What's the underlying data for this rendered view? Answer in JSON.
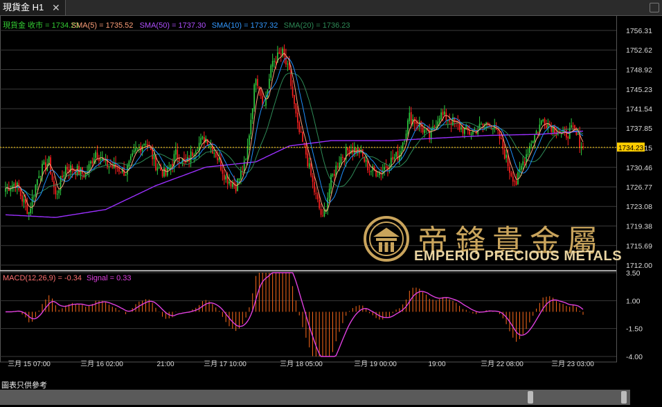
{
  "tab": {
    "title": "現貨金 H1",
    "close": "✕"
  },
  "footer_note": "圖表只供參考",
  "logo": {
    "cn": "帝鋒貴金屬",
    "en": "EMPERIO PRECIOUS METALS"
  },
  "colors": {
    "candle_up": "#2ecc40",
    "candle_down": "#ff2020",
    "sma5": "#ffa07a",
    "sma50": "#9b30ff",
    "sma10": "#1e90ff",
    "sma20": "#2e8b57",
    "macd_hist": "#ff6a1a",
    "signal": "#e040e0",
    "grid": "#3a3a3a",
    "last_price": "#ffcc00"
  },
  "chart_data": [
    {
      "type": "candlestick",
      "legend": [
        {
          "text": "現貨金 收市 = 1734.23",
          "color": "#33cc33"
        },
        {
          "text": "SMA(5) = 1735.52",
          "color": "#ffa07a"
        },
        {
          "text": "SMA(50) = 1737.30",
          "color": "#b050ff"
        },
        {
          "text": "SMA(10) = 1737.32",
          "color": "#3399ff"
        },
        {
          "text": "SMA(20) = 1736.23",
          "color": "#2e8b57"
        }
      ],
      "y_ticks": [
        "1756.31",
        "1752.62",
        "1748.92",
        "1745.23",
        "1741.54",
        "1737.85",
        "1734.15",
        "1730.46",
        "1726.77",
        "1723.08",
        "1719.38",
        "1715.69",
        "1712.00"
      ],
      "ylim": [
        1712.0,
        1756.31
      ],
      "last_price": 1734.23,
      "last_price_label": "1734.23",
      "x_ticks": [
        "三月 15 07:00",
        "三月 16 02:00",
        "21:00",
        "三月 17 10:00",
        "三月 18 05:00",
        "三月 19 00:00",
        "19:00",
        "三月 22 08:00",
        "三月 23 03:00"
      ],
      "close_anchors": [
        [
          0,
          1726.5
        ],
        [
          6,
          1727.5
        ],
        [
          10,
          1724.5
        ],
        [
          14,
          1722.0
        ],
        [
          20,
          1729.5
        ],
        [
          26,
          1731.5
        ],
        [
          30,
          1725.0
        ],
        [
          36,
          1730.5
        ],
        [
          42,
          1730.0
        ],
        [
          48,
          1729.0
        ],
        [
          54,
          1733.5
        ],
        [
          60,
          1731.0
        ],
        [
          66,
          1730.5
        ],
        [
          72,
          1729.5
        ],
        [
          78,
          1733.5
        ],
        [
          84,
          1735.5
        ],
        [
          90,
          1731.0
        ],
        [
          96,
          1729.0
        ],
        [
          102,
          1733.0
        ],
        [
          108,
          1731.0
        ],
        [
          114,
          1734.5
        ],
        [
          120,
          1736.0
        ],
        [
          126,
          1733.0
        ],
        [
          132,
          1728.5
        ],
        [
          138,
          1727.0
        ],
        [
          144,
          1731.5
        ],
        [
          150,
          1748.0
        ],
        [
          155,
          1742.0
        ],
        [
          160,
          1750.5
        ],
        [
          166,
          1752.0
        ],
        [
          170,
          1748.0
        ],
        [
          175,
          1738.0
        ],
        [
          180,
          1733.0
        ],
        [
          185,
          1726.0
        ],
        [
          190,
          1720.5
        ],
        [
          195,
          1728.0
        ],
        [
          200,
          1732.0
        ],
        [
          206,
          1734.0
        ],
        [
          212,
          1733.5
        ],
        [
          218,
          1730.0
        ],
        [
          224,
          1729.5
        ],
        [
          230,
          1731.5
        ],
        [
          236,
          1733.0
        ],
        [
          242,
          1740.0
        ],
        [
          248,
          1738.5
        ],
        [
          254,
          1736.0
        ],
        [
          260,
          1740.5
        ],
        [
          266,
          1739.5
        ],
        [
          272,
          1738.0
        ],
        [
          278,
          1737.0
        ],
        [
          284,
          1738.0
        ],
        [
          290,
          1739.0
        ],
        [
          296,
          1736.0
        ],
        [
          302,
          1730.0
        ],
        [
          306,
          1727.5
        ],
        [
          310,
          1731.5
        ],
        [
          316,
          1736.0
        ],
        [
          322,
          1739.5
        ],
        [
          328,
          1738.0
        ],
        [
          334,
          1736.5
        ],
        [
          340,
          1737.5
        ],
        [
          346,
          1734.23
        ]
      ],
      "sma50_anchors": [
        [
          0,
          1721.5
        ],
        [
          30,
          1721.0
        ],
        [
          60,
          1722.5
        ],
        [
          90,
          1727.0
        ],
        [
          120,
          1730.5
        ],
        [
          150,
          1731.5
        ],
        [
          170,
          1734.5
        ],
        [
          195,
          1735.5
        ],
        [
          230,
          1735.5
        ],
        [
          260,
          1736.0
        ],
        [
          290,
          1736.5
        ],
        [
          320,
          1736.7
        ],
        [
          346,
          1737.3
        ]
      ]
    },
    {
      "type": "macd",
      "legend": [
        {
          "text": "MACD(12,26,9) = -0.34",
          "color": "#ff7070"
        },
        {
          "text": "Signal = 0.33",
          "color": "#e040e0"
        }
      ],
      "y_ticks": [
        "3.50",
        "1.00",
        "-1.50",
        "-4.00"
      ],
      "ylim": [
        -4.0,
        3.5
      ]
    }
  ]
}
